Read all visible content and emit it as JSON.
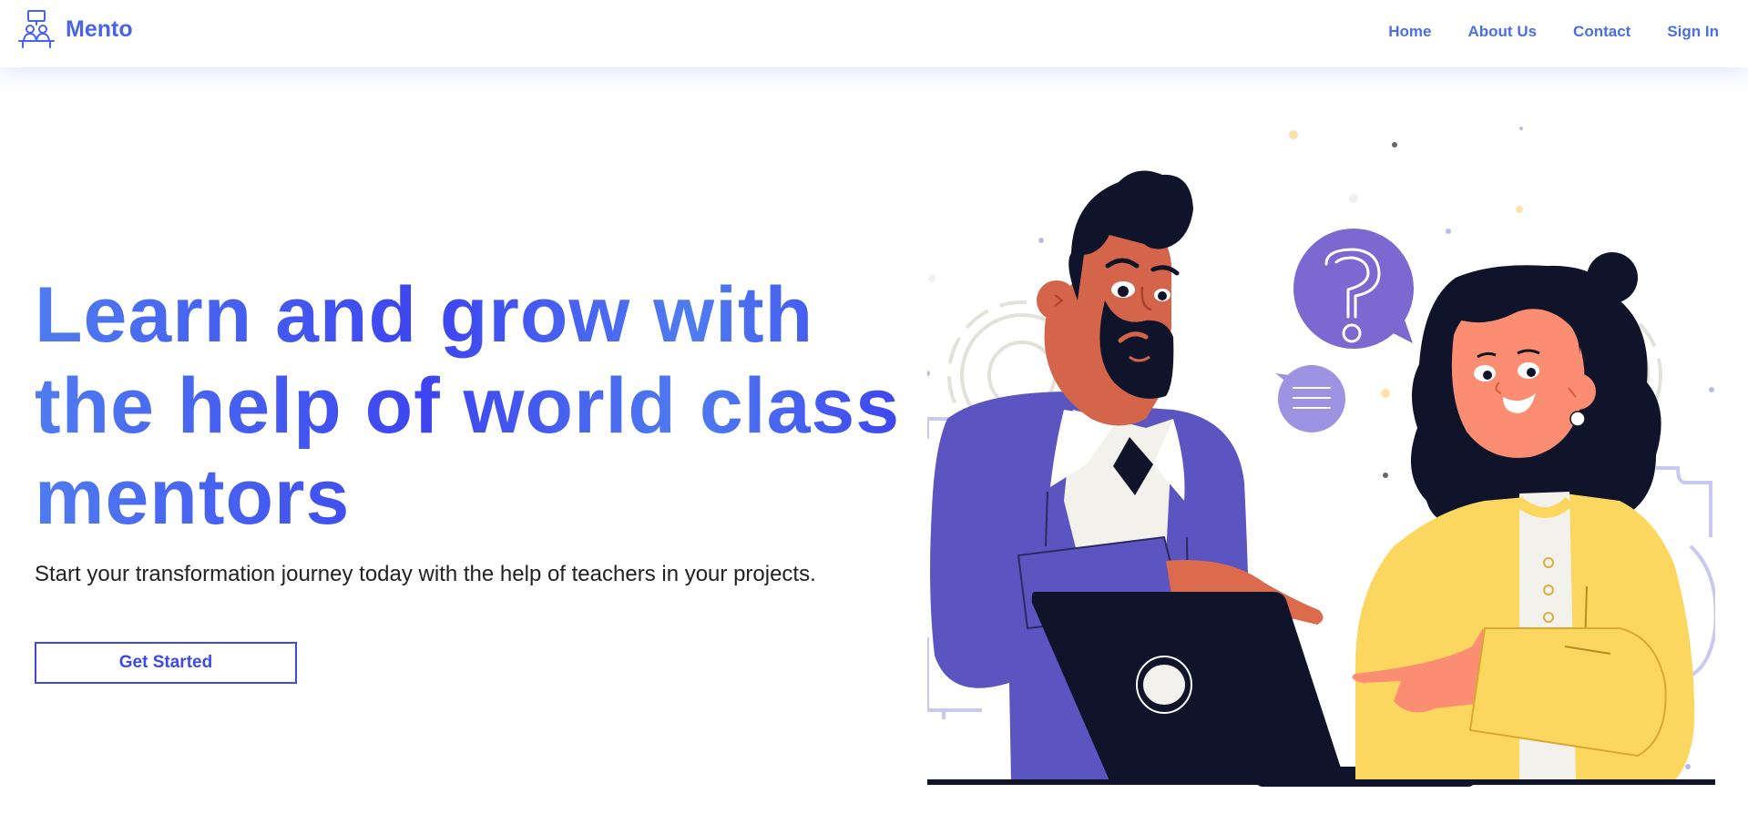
{
  "header": {
    "brand": "Mento",
    "logo_icon": "mentor-desk-icon",
    "nav": [
      {
        "label": "Home"
      },
      {
        "label": "About Us"
      },
      {
        "label": "Contact"
      },
      {
        "label": "Sign In"
      }
    ]
  },
  "hero": {
    "title": "Learn and grow with the help of world class mentors",
    "subtitle": "Start your transformation journey today with the help of teachers in your projects.",
    "cta_label": "Get Started"
  },
  "illustration": {
    "question_icon": "question-mark-icon",
    "message_icon": "message-lines-icon"
  },
  "colors": {
    "brand": "#4a64e6",
    "accent": "#3d4ae8",
    "purple": "#5a55c0",
    "yellow": "#fcd760",
    "dark": "#10142a"
  }
}
